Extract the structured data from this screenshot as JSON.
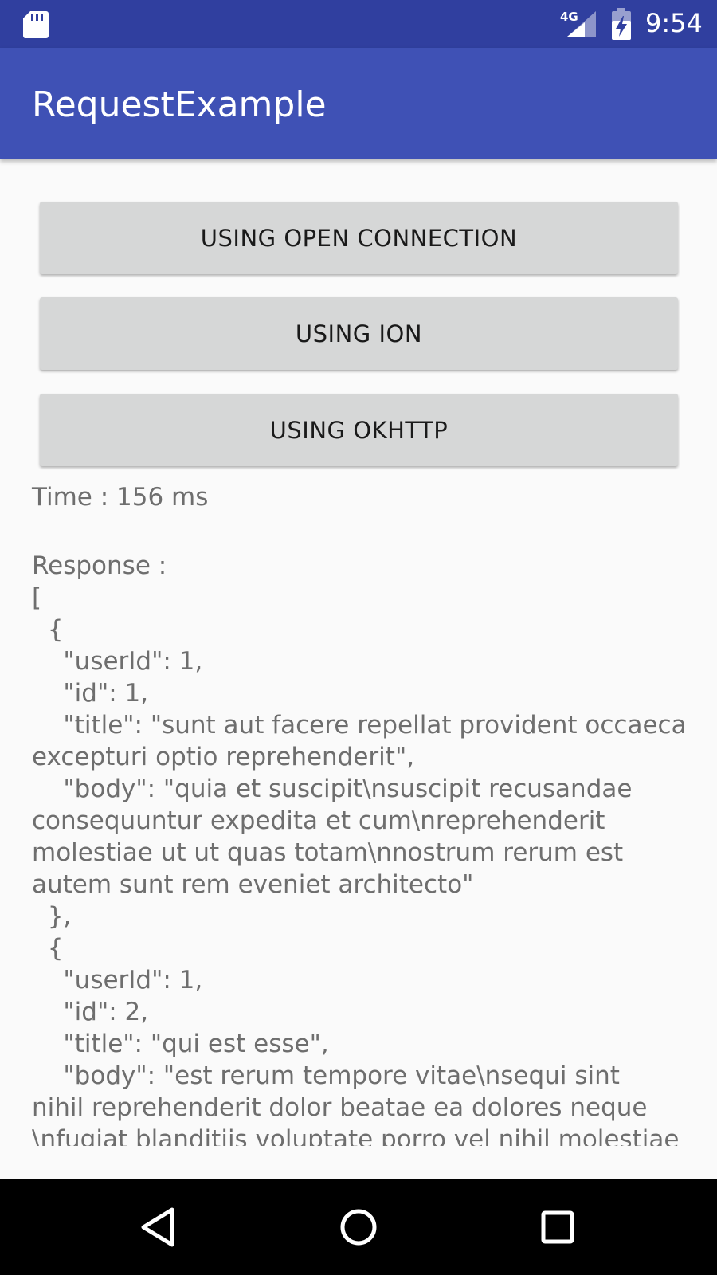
{
  "status_bar": {
    "network": "4G",
    "time": "9:54"
  },
  "app_bar": {
    "title": "RequestExample"
  },
  "buttons": {
    "open_connection": "USING OPEN CONNECTION",
    "ion": "USING ION",
    "okhttp": "USING OKHTTP"
  },
  "result": {
    "time_text": "Time : 156 ms",
    "response_lines": [
      "Response :",
      "[",
      "  {",
      "    \"userId\": 1,",
      "    \"id\": 1,",
      "    \"title\": \"sunt aut facere repellat provident occaecati",
      "excepturi optio reprehenderit\",",
      "    \"body\": \"quia et suscipit\\nsuscipit recusandae",
      "consequuntur expedita et cum\\nreprehenderit",
      "molestiae ut ut quas totam\\nnostrum rerum est",
      "autem sunt rem eveniet architecto\"",
      "  },",
      "  {",
      "    \"userId\": 1,",
      "    \"id\": 2,",
      "    \"title\": \"qui est esse\",",
      "    \"body\": \"est rerum tempore vitae\\nsequi sint",
      "nihil reprehenderit dolor beatae ea dolores neque",
      "\\nfugiat blanditiis voluptate porro vel nihil molestiae"
    ]
  },
  "icons": {
    "sd_card": "sd-card-icon",
    "signal": "signal-icon",
    "battery": "battery-charging-icon",
    "back": "back-triangle-icon",
    "home": "home-circle-icon",
    "recent": "recent-apps-square-icon"
  },
  "colors": {
    "status_bar": "#303f9f",
    "app_bar": "#3f51b5",
    "button": "#d6d7d7",
    "body_text": "#6e6e6e"
  }
}
